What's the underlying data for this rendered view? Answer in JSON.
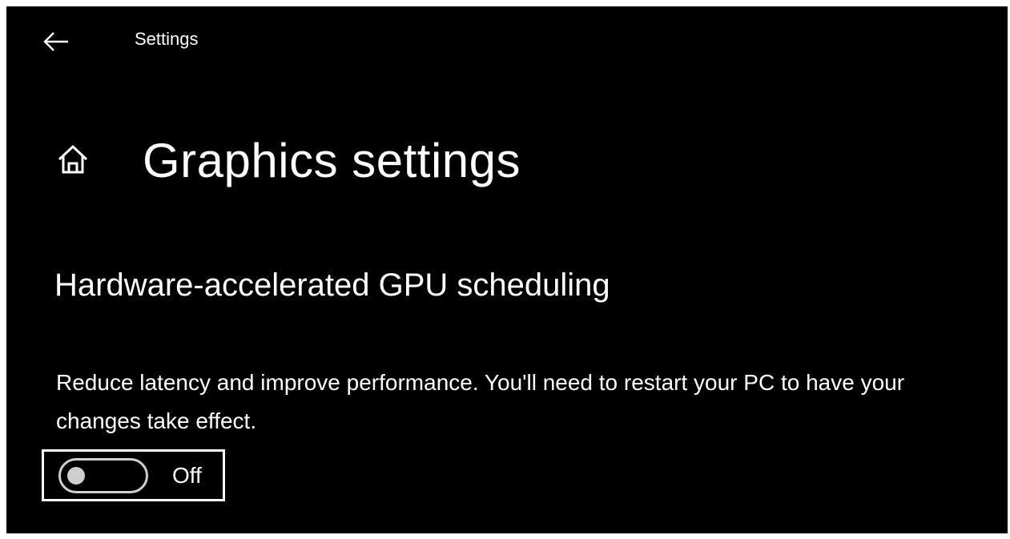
{
  "titlebar": {
    "back_icon": "back-arrow-icon",
    "app_title": "Settings"
  },
  "header": {
    "home_icon": "home-icon",
    "page_title": "Graphics settings"
  },
  "gpu_scheduling": {
    "section_title": "Hardware-accelerated GPU scheduling",
    "description": "Reduce latency and improve performance. You'll need to restart your PC to have your changes take effect.",
    "toggle_state_label": "Off",
    "toggle_on": false
  },
  "colors": {
    "background": "#000000",
    "text": "#ffffff",
    "toggle_off": "#cfcfcf"
  }
}
